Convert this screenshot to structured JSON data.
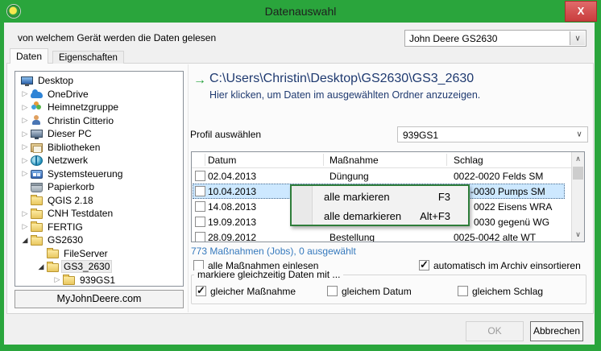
{
  "window": {
    "title": "Datenauswahl"
  },
  "device": {
    "label": "von welchem Gerät werden die Daten gelesen",
    "value": "John Deere GS2630"
  },
  "tabs": [
    {
      "label": "Daten",
      "active": true
    },
    {
      "label": "Eigenschaften",
      "active": false
    }
  ],
  "tree": {
    "items": [
      {
        "label": "Desktop",
        "level": 0,
        "arrow": "none",
        "icon": "desktop",
        "selected": false
      },
      {
        "label": "OneDrive",
        "level": 1,
        "arrow": "collapsed",
        "icon": "onedrive-cloud",
        "selected": false
      },
      {
        "label": "Heimnetzgruppe",
        "level": 1,
        "arrow": "collapsed",
        "icon": "homegroup",
        "selected": false
      },
      {
        "label": "Christin Citterio",
        "level": 1,
        "arrow": "collapsed",
        "icon": "user",
        "selected": false
      },
      {
        "label": "Dieser PC",
        "level": 1,
        "arrow": "collapsed",
        "icon": "computer",
        "selected": false
      },
      {
        "label": "Bibliotheken",
        "level": 1,
        "arrow": "collapsed",
        "icon": "libraries",
        "selected": false
      },
      {
        "label": "Netzwerk",
        "level": 1,
        "arrow": "collapsed",
        "icon": "network-globe",
        "selected": false
      },
      {
        "label": "Systemsteuerung",
        "level": 1,
        "arrow": "collapsed",
        "icon": "control-panel",
        "selected": false
      },
      {
        "label": "Papierkorb",
        "level": 1,
        "arrow": "none",
        "icon": "recycle-bin",
        "selected": false
      },
      {
        "label": "QGIS 2.18",
        "level": 1,
        "arrow": "none",
        "icon": "folder",
        "selected": false
      },
      {
        "label": "CNH Testdaten",
        "level": 1,
        "arrow": "collapsed",
        "icon": "folder",
        "selected": false
      },
      {
        "label": "FERTIG",
        "level": 1,
        "arrow": "collapsed",
        "icon": "folder",
        "selected": false
      },
      {
        "label": "GS2630",
        "level": 1,
        "arrow": "expanded",
        "icon": "folder",
        "selected": false
      },
      {
        "label": "FileServer",
        "level": 2,
        "arrow": "none",
        "icon": "folder",
        "selected": false
      },
      {
        "label": "GS3_2630",
        "level": 2,
        "arrow": "expanded",
        "icon": "folder",
        "selected": true
      },
      {
        "label": "939GS1",
        "level": 3,
        "arrow": "collapsed",
        "icon": "folder",
        "selected": false
      }
    ]
  },
  "myjohndeere_button": "MyJohnDeere.com",
  "folder_header": {
    "path": "C:\\Users\\Christin\\Desktop\\GS2630\\GS3_2630",
    "hint": "Hier klicken, um Daten im ausgewählten Ordner anzuzeigen."
  },
  "profile": {
    "label": "Profil auswählen",
    "value": "939GS1"
  },
  "table": {
    "columns": [
      "Datum",
      "Maßnahme",
      "Schlag"
    ],
    "rows": [
      {
        "checked": false,
        "selected": false,
        "datum": "02.04.2013",
        "massnahme": "Düngung",
        "schlag": "0022-0020 Felds SM"
      },
      {
        "checked": false,
        "selected": true,
        "datum": "10.04.2013",
        "massnahme": "",
        "schlag": "-0030 Pumps SM"
      },
      {
        "checked": false,
        "selected": false,
        "datum": "14.08.2013",
        "massnahme": "",
        "schlag": "0022 Eisens WRA"
      },
      {
        "checked": false,
        "selected": false,
        "datum": "19.09.2013",
        "massnahme": "",
        "schlag": "0030 gegenü WG"
      },
      {
        "checked": false,
        "selected": false,
        "datum": "28.09.2012",
        "massnahme": "Bestellung",
        "schlag": "0025-0042 alte  WT"
      }
    ]
  },
  "status": "773 Maßnahmen (Jobs), 0 ausgewählt",
  "context_menu": {
    "items": [
      {
        "label": "alle markieren",
        "shortcut": "F3"
      },
      {
        "label": "alle demarkieren",
        "shortcut": "Alt+F3"
      }
    ]
  },
  "options": {
    "read_all": {
      "label": "alle Maßnahmen einlesen",
      "checked": false
    },
    "auto_archive": {
      "label": "automatisch im Archiv einsortieren",
      "checked": true
    }
  },
  "group": {
    "label": "markiere gleichzeitig Daten mit ...",
    "items": [
      {
        "label": "gleicher Maßnahme",
        "checked": true
      },
      {
        "label": "gleichem Datum",
        "checked": false
      },
      {
        "label": "gleichem Schlag",
        "checked": false
      }
    ]
  },
  "footer": {
    "ok": "OK",
    "cancel": "Abbrechen"
  },
  "colors": {
    "frame_green": "#2aa53c",
    "menu_border_green": "#2e7d3a",
    "close_red": "#c93d3d",
    "path_navy": "#1f3a70",
    "status_blue": "#3579bd",
    "selection_blue": "#cde8ff"
  }
}
